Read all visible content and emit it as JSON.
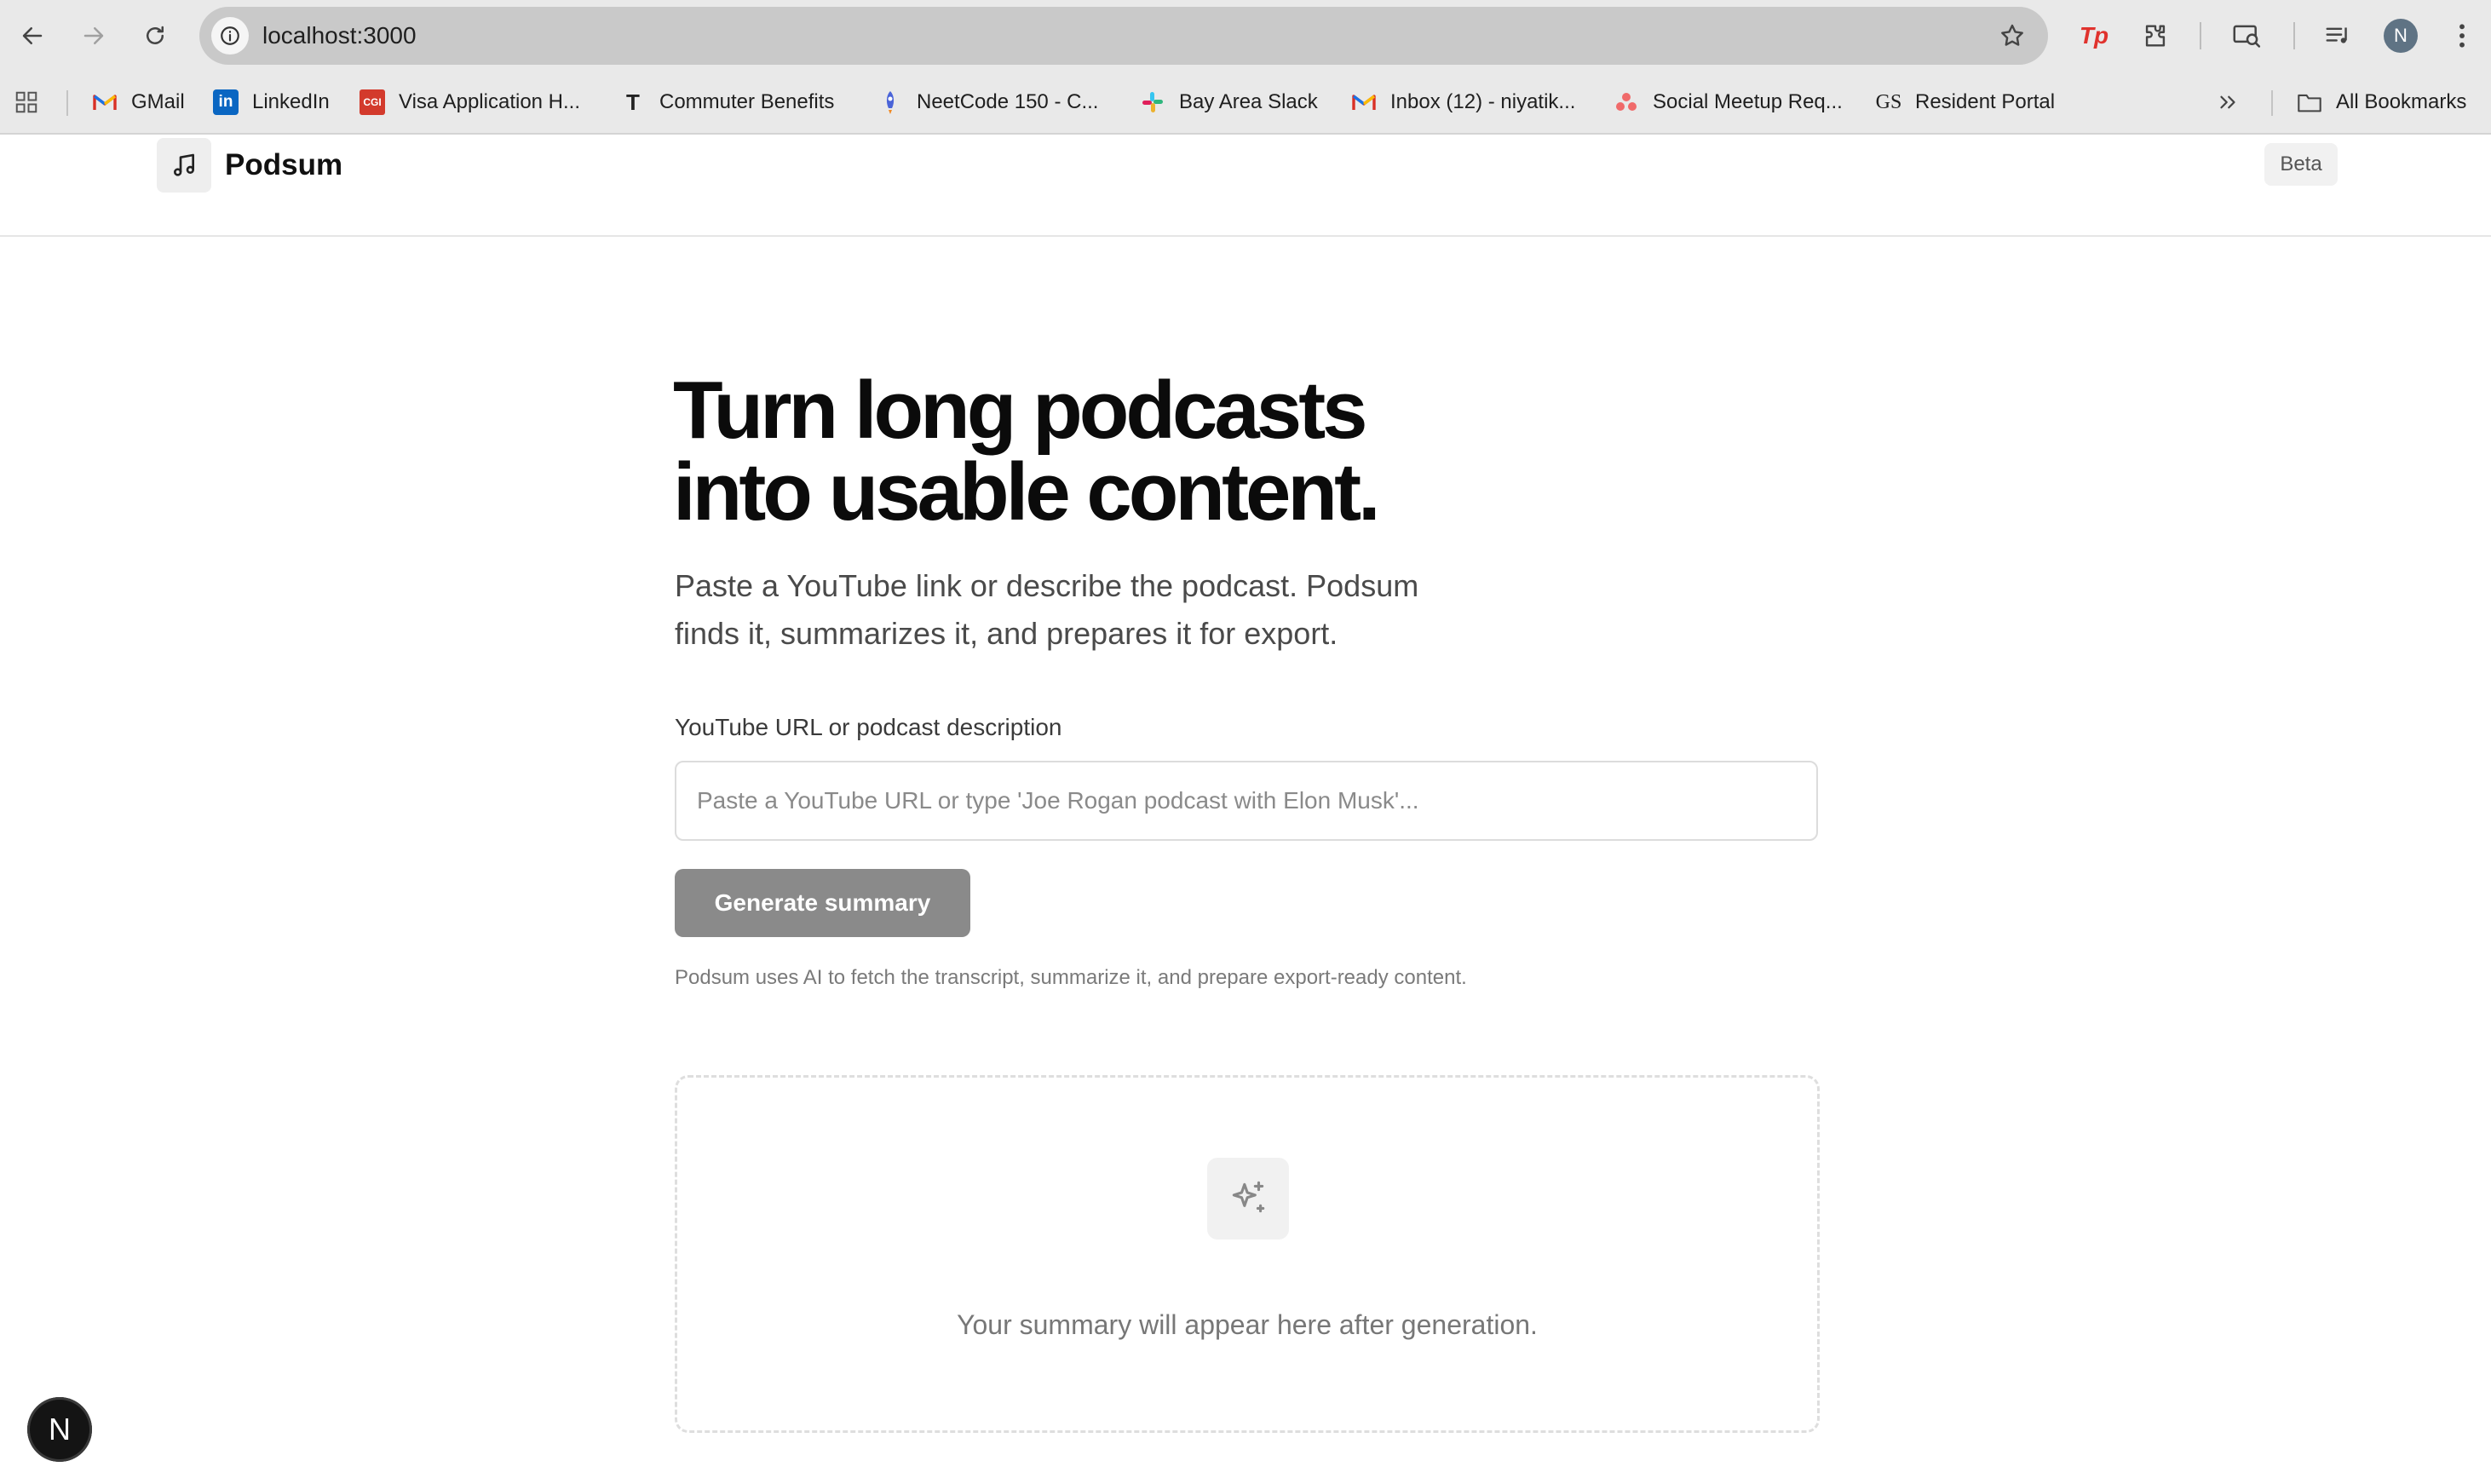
{
  "browser": {
    "url": "localhost:3000",
    "profile_initial": "N",
    "bookmarks": [
      {
        "label": "GMail",
        "icon": "gmail-icon"
      },
      {
        "label": "LinkedIn",
        "icon": "linkedin-icon"
      },
      {
        "label": "Visa Application H...",
        "icon": "visa-icon"
      },
      {
        "label": "Commuter Benefits",
        "icon": "commuter-icon"
      },
      {
        "label": "NeetCode 150 - C...",
        "icon": "rocket-icon"
      },
      {
        "label": "Bay Area Slack",
        "icon": "slack-icon"
      },
      {
        "label": "Inbox (12) - niyatik...",
        "icon": "gmail-icon"
      },
      {
        "label": "Social Meetup Req...",
        "icon": "asana-icon"
      },
      {
        "label": "Resident Portal",
        "icon": "gs-icon"
      }
    ],
    "all_bookmarks_label": "All Bookmarks"
  },
  "app": {
    "brand": "Podsum",
    "badge": "Beta",
    "hero_title_line1": "Turn long podcasts",
    "hero_title_line2": "into usable content.",
    "hero_sub_line1": "Paste a YouTube link or describe the podcast. Podsum",
    "hero_sub_line2": "finds it, summarizes it, and prepares it for export.",
    "field_label": "YouTube URL or podcast description",
    "input_placeholder": "Paste a YouTube URL or type 'Joe Rogan podcast with Elon Musk'...",
    "input_value": "",
    "button_label": "Generate summary",
    "helper_text": "Podsum uses AI to fetch the transcript, summarize it, and prepare export-ready content.",
    "result_placeholder": "Your summary will appear here after generation.",
    "dev_badge": "N"
  },
  "colors": {
    "button_bg": "#8a8a8a",
    "title": "#0b0b0b",
    "chrome_bg": "#e9e9e9"
  }
}
